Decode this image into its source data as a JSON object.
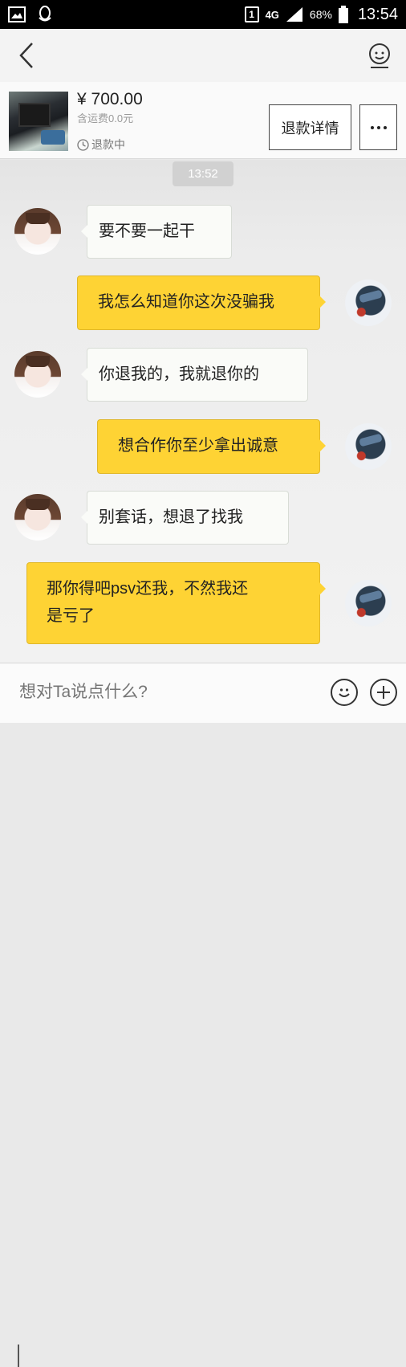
{
  "status_bar": {
    "sim_slot": "1",
    "network": "4G",
    "battery": "68%",
    "time": "13:54",
    "icons": [
      "gallery-icon",
      "qq-icon",
      "signal-icon",
      "battery-icon"
    ]
  },
  "nav": {
    "back_icon": "chevron-left-icon",
    "profile_icon": "user-face-icon"
  },
  "product": {
    "price": "¥ 700.00",
    "shipping": "含运费0.0元",
    "status": "退款中",
    "status_icon": "clock-icon",
    "refund_button": "退款详情",
    "more_icon": "more-dots-icon"
  },
  "chat": {
    "timestamp": "13:52",
    "messages": [
      {
        "side": "left",
        "text": "要不要一起干"
      },
      {
        "side": "right",
        "text": "我怎么知道你这次没骗我"
      },
      {
        "side": "left",
        "text": "你退我的，我就退你的"
      },
      {
        "side": "right",
        "text": "想合作你至少拿出诚意"
      },
      {
        "side": "left",
        "text": "别套话，想退了找我"
      },
      {
        "side": "right",
        "text_line1": "那你得吧psv还我，不然我还",
        "text_line2": "是亏了"
      }
    ]
  },
  "input": {
    "placeholder": "想对Ta说点什么?",
    "emoji_icon": "emoji-icon",
    "add_icon": "plus-icon"
  },
  "colors": {
    "accent_yellow": "#FED334",
    "bubble_left": "#FAFBF8"
  }
}
